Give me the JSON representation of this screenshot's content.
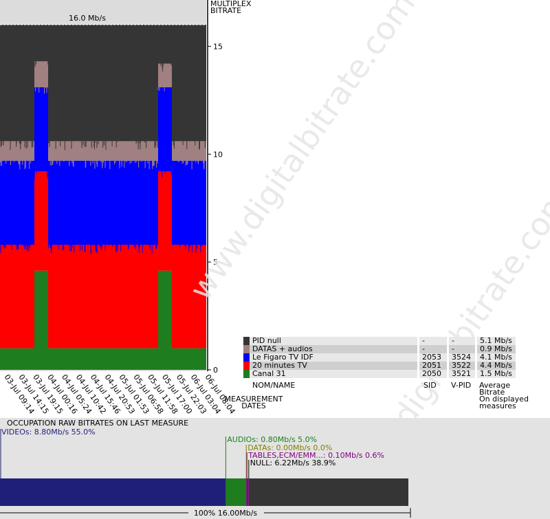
{
  "watermark": "www.digitalbitrate.com",
  "chart_data": {
    "type": "area",
    "title": "",
    "max_label": "16.0 Mb/s",
    "ylabel": "MULTIPLEX BITRATE",
    "xlabel": "MEASUREMENT DATES",
    "ylim": [
      0,
      16.0
    ],
    "yticks": [
      0,
      5,
      10,
      15
    ],
    "x": [
      "03-Jul 09:14",
      "03-Jul 14:15",
      "03-Jul 19:15",
      "04-Jul 00:16",
      "04-Jul 05:24",
      "04-Jul 10:42",
      "04-Jul 15:46",
      "04-Jul 20:53",
      "05-Jul 01:53",
      "05-Jul 06:58",
      "05-Jul 11:58",
      "05-Jul 17:00",
      "05-Jul 22:03",
      "06-Jul 03:04",
      "06-Jul 08:04"
    ],
    "series": [
      {
        "name": "Canal 31",
        "color": "#1e7d1e",
        "values": [
          1.0,
          1.0,
          1.0,
          4.6,
          1.0,
          1.0,
          1.0,
          1.0,
          1.0,
          1.0,
          1.0,
          1.0,
          4.6,
          1.0,
          1.0,
          1.0
        ]
      },
      {
        "name": "20 minutes TV",
        "color": "#ff0000",
        "values": [
          4.8,
          4.8,
          4.8,
          4.6,
          4.8,
          4.8,
          4.8,
          4.8,
          4.8,
          4.8,
          4.8,
          4.8,
          4.6,
          4.8,
          4.8,
          4.8
        ]
      },
      {
        "name": "Le Figaro TV IDF",
        "color": "#0000ff",
        "values": [
          3.9,
          3.9,
          3.9,
          3.9,
          3.9,
          3.9,
          3.9,
          3.9,
          3.9,
          3.9,
          3.9,
          3.9,
          3.9,
          3.9,
          3.9,
          3.9
        ]
      },
      {
        "name": "DATAS + audios",
        "color": "#a08080",
        "values": [
          0.9,
          0.9,
          0.9,
          1.2,
          0.9,
          0.9,
          0.9,
          0.9,
          0.9,
          0.9,
          0.9,
          0.9,
          1.1,
          0.9,
          0.9,
          0.9
        ]
      },
      {
        "name": "PID null",
        "color": "#353535",
        "values": [
          5.4,
          5.4,
          5.4,
          1.7,
          5.4,
          5.4,
          5.4,
          5.4,
          5.4,
          5.4,
          5.4,
          5.4,
          1.8,
          5.4,
          5.4,
          5.4
        ]
      }
    ],
    "grid": false
  },
  "legend": {
    "rows": [
      {
        "name": "PID null",
        "color": "#353535",
        "sid": "-",
        "vpid": "-",
        "avg": "5.1 Mb/s"
      },
      {
        "name": "DATAS + audios",
        "color": "#a08080",
        "sid": "-",
        "vpid": "-",
        "avg": "0.9 Mb/s"
      },
      {
        "name": "Le Figaro TV IDF",
        "color": "#0000ff",
        "sid": "2053",
        "vpid": "3524",
        "avg": "4.1 Mb/s"
      },
      {
        "name": "20 minutes TV",
        "color": "#ff0000",
        "sid": "2051",
        "vpid": "3522",
        "avg": "4.4 Mb/s"
      },
      {
        "name": "Canal 31",
        "color": "#1e7d1e",
        "sid": "2050",
        "vpid": "3521",
        "avg": "1.5 Mb/s"
      }
    ],
    "headers": {
      "name": "NOM/NAME",
      "sid": "SID",
      "vpid": "V-PID",
      "avg": "Average\nBitrate\nOn displayed\nmeasures"
    }
  },
  "occupation": {
    "title": "OCCUPATION RAW BITRATES ON LAST MEASURE",
    "total_label": "100%  16.00Mb/s",
    "segments": [
      {
        "label": "VIDEOs: 8.80Mb/s  55.0%",
        "color": "#1f1f7a",
        "label_color": "#1f1f7a",
        "fraction": 0.55
      },
      {
        "label": "AUDIOs: 0.80Mb/s  5.0%",
        "color": "#1e7d1e",
        "label_color": "#1e7d1e",
        "fraction": 0.05
      },
      {
        "label": "DATAs: 0.00Mb/s  0.0%",
        "color": "#808000",
        "label_color": "#808000",
        "fraction": 0.0
      },
      {
        "label": "TABLES,ECM/EMM...: 0.10Mb/s  0.6%",
        "color": "#800080",
        "label_color": "#800080",
        "fraction": 0.006
      },
      {
        "label": "NULL: 6.22Mb/s  38.9%",
        "color": "#353535",
        "label_color": "#000000",
        "fraction": 0.389
      }
    ]
  }
}
